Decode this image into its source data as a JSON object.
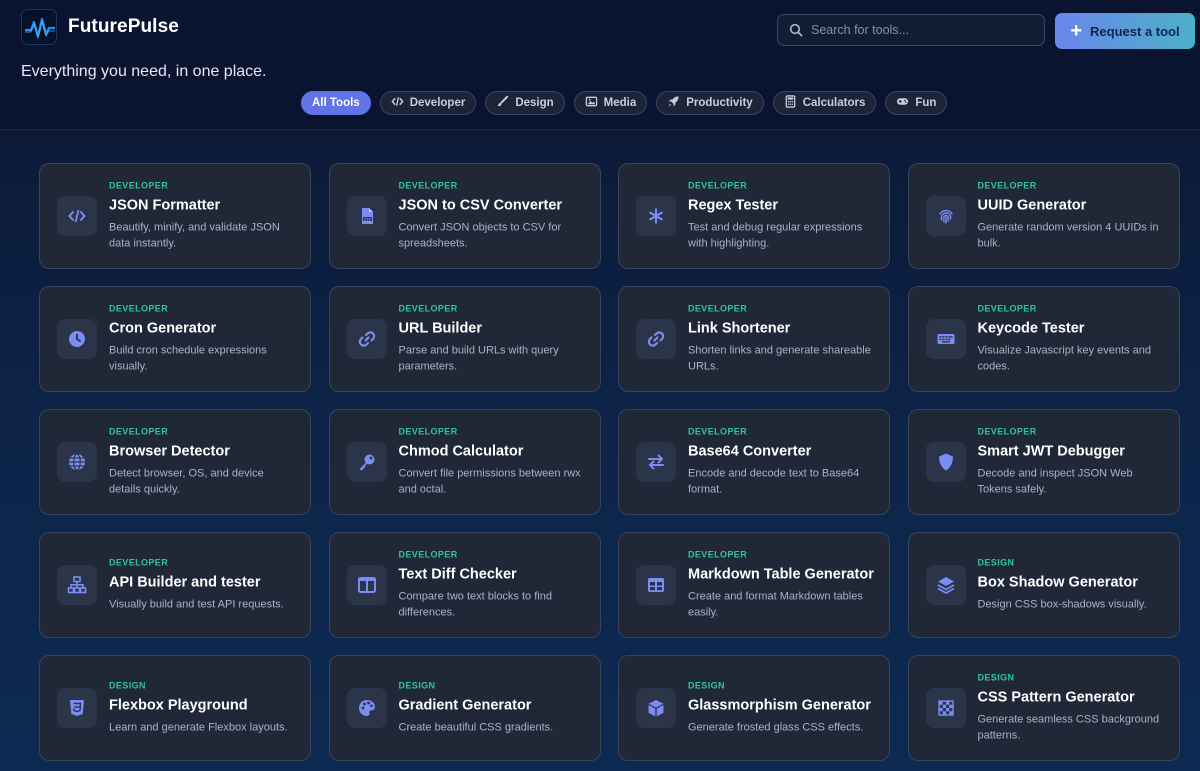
{
  "header": {
    "brand": "FuturePulse",
    "tagline": "Everything you need, in one place.",
    "search_placeholder": "Search for tools...",
    "request_label": "Request a tool"
  },
  "categories": [
    {
      "label": "All Tools",
      "icon": "none",
      "active": true
    },
    {
      "label": "Developer",
      "icon": "code-icon"
    },
    {
      "label": "Design",
      "icon": "brush-icon"
    },
    {
      "label": "Media",
      "icon": "image-icon"
    },
    {
      "label": "Productivity",
      "icon": "rocket-icon"
    },
    {
      "label": "Calculators",
      "icon": "calculator-icon"
    },
    {
      "label": "Fun",
      "icon": "gamepad-icon"
    }
  ],
  "tools": [
    {
      "tag": "DEVELOPER",
      "title": "JSON Formatter",
      "desc": "Beautify, minify, and validate JSON data instantly.",
      "icon": "code-icon"
    },
    {
      "tag": "DEVELOPER",
      "title": "JSON to CSV Converter",
      "desc": "Convert JSON objects to CSV for spreadsheets.",
      "icon": "csv-file-icon"
    },
    {
      "tag": "DEVELOPER",
      "title": "Regex Tester",
      "desc": "Test and debug regular expressions with highlighting.",
      "icon": "asterisk-icon"
    },
    {
      "tag": "DEVELOPER",
      "title": "UUID Generator",
      "desc": "Generate random version 4 UUIDs in bulk.",
      "icon": "fingerprint-icon"
    },
    {
      "tag": "DEVELOPER",
      "title": "Cron Generator",
      "desc": "Build cron schedule expressions visually.",
      "icon": "clock-icon"
    },
    {
      "tag": "DEVELOPER",
      "title": "URL Builder",
      "desc": "Parse and build URLs with query parameters.",
      "icon": "link-icon"
    },
    {
      "tag": "DEVELOPER",
      "title": "Link Shortener",
      "desc": "Shorten links and generate shareable URLs.",
      "icon": "link-icon"
    },
    {
      "tag": "DEVELOPER",
      "title": "Keycode Tester",
      "desc": "Visualize Javascript key events and codes.",
      "icon": "keyboard-icon"
    },
    {
      "tag": "DEVELOPER",
      "title": "Browser Detector",
      "desc": "Detect browser, OS, and device details quickly.",
      "icon": "globe-icon"
    },
    {
      "tag": "DEVELOPER",
      "title": "Chmod Calculator",
      "desc": "Convert file permissions between rwx and octal.",
      "icon": "key-icon"
    },
    {
      "tag": "DEVELOPER",
      "title": "Base64 Converter",
      "desc": "Encode and decode text to Base64 format.",
      "icon": "swap-arrows-icon"
    },
    {
      "tag": "DEVELOPER",
      "title": "Smart JWT Debugger",
      "desc": "Decode and inspect JSON Web Tokens safely.",
      "icon": "shield-icon"
    },
    {
      "tag": "DEVELOPER",
      "title": "API Builder and tester",
      "desc": "Visually build and test API requests.",
      "icon": "sitemap-icon"
    },
    {
      "tag": "DEVELOPER",
      "title": "Text Diff Checker",
      "desc": "Compare two text blocks to find differences.",
      "icon": "columns-icon"
    },
    {
      "tag": "DEVELOPER",
      "title": "Markdown Table Generator",
      "desc": "Create and format Markdown tables easily.",
      "icon": "table-icon"
    },
    {
      "tag": "DESIGN",
      "title": "Box Shadow Generator",
      "desc": "Design CSS box-shadows visually.",
      "icon": "layers-icon"
    },
    {
      "tag": "DESIGN",
      "title": "Flexbox Playground",
      "desc": "Learn and generate Flexbox layouts.",
      "icon": "css3-icon"
    },
    {
      "tag": "DESIGN",
      "title": "Gradient Generator",
      "desc": "Create beautiful CSS gradients.",
      "icon": "palette-icon"
    },
    {
      "tag": "DESIGN",
      "title": "Glassmorphism Generator",
      "desc": "Generate frosted glass CSS effects.",
      "icon": "cube-icon"
    },
    {
      "tag": "DESIGN",
      "title": "CSS Pattern Generator",
      "desc": "Generate seamless CSS background patterns.",
      "icon": "checkerboard-icon"
    }
  ],
  "colors": {
    "accent": "#6173e6",
    "tag_green": "#2fc596",
    "icon_blue": "#7b8cf2",
    "card_bg": "#202838"
  }
}
